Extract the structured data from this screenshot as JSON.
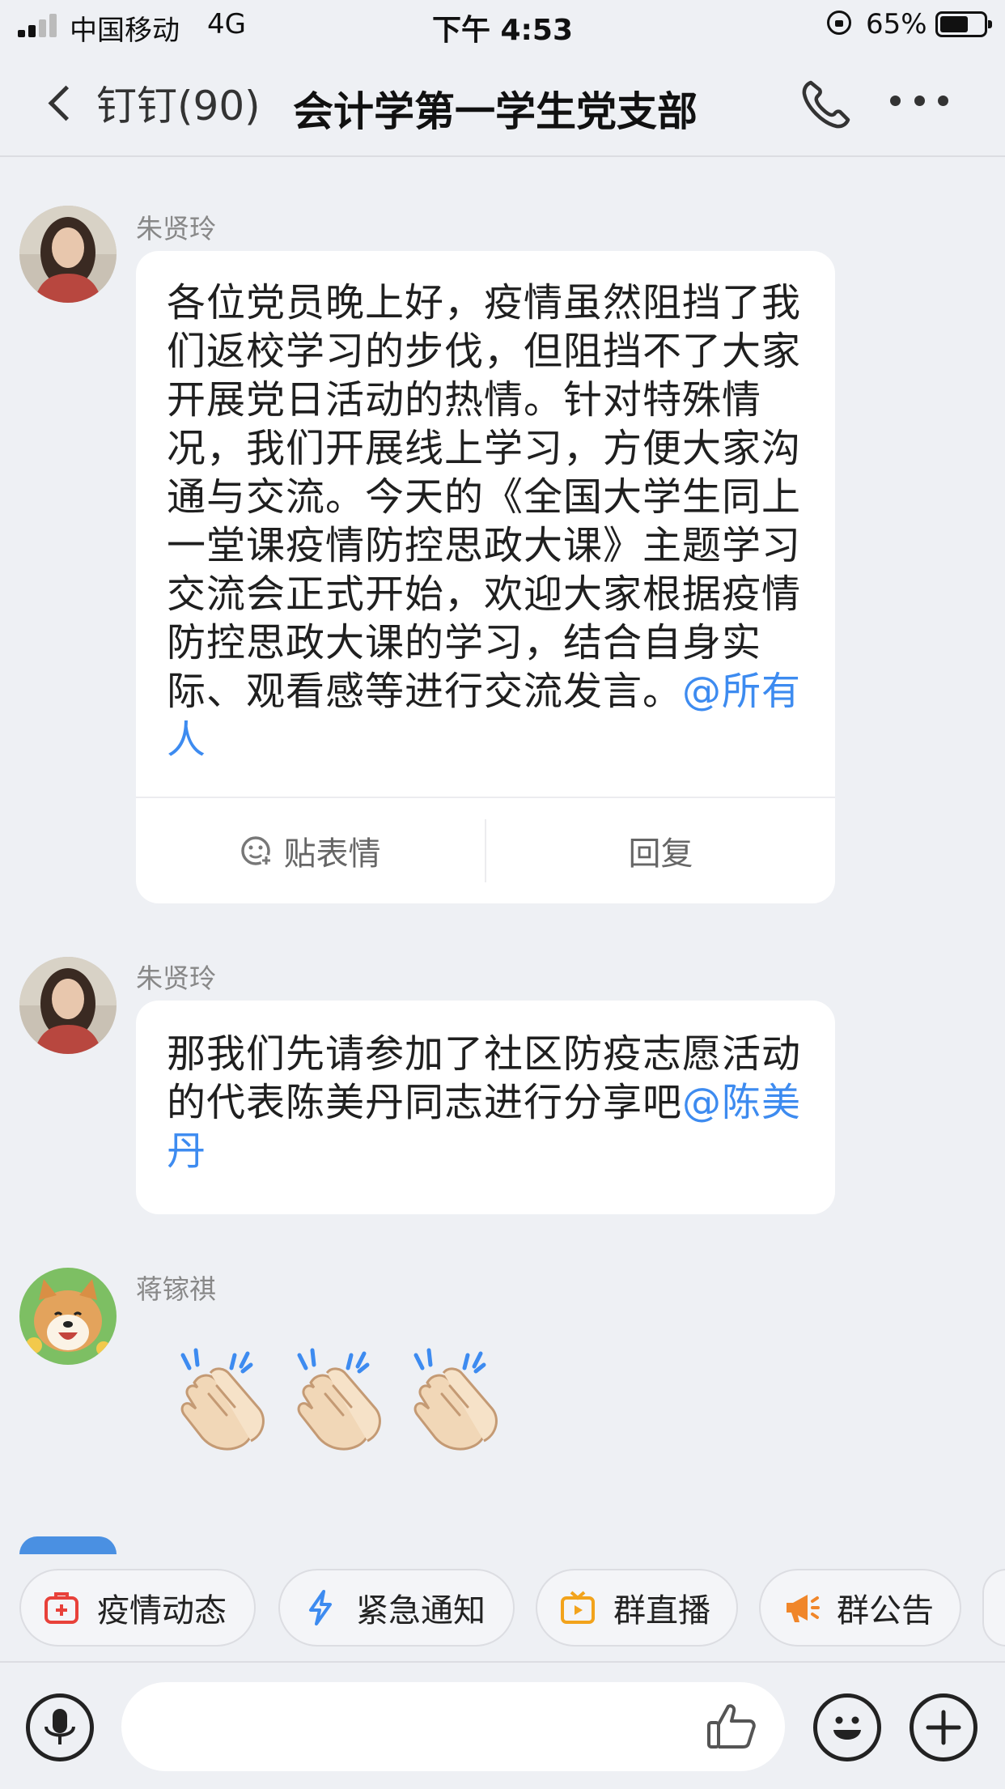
{
  "status_bar": {
    "carrier": "中国移动",
    "network": "4G",
    "time": "下午 4:53",
    "battery_percent": "65%",
    "battery_level": 0.65
  },
  "nav": {
    "back_label": "钉钉(90)",
    "title": "会计学第一学生党支部"
  },
  "messages": [
    {
      "sender": "朱贤玲",
      "text": "各位党员晚上好，疫情虽然阻挡了我们返校学习的步伐，但阻挡不了大家开展党日活动的热情。针对特殊情况，我们开展线上学习，方便大家沟通与交流。今天的《全国大学生同上一堂课疫情防控思政大课》主题学习交流会正式开始，欢迎大家根据疫情防控思政大课的学习，结合自身实际、观看感等进行交流发言。",
      "mention": "@所有人",
      "action_react": "贴表情",
      "action_reply": "回复"
    },
    {
      "sender": "朱贤玲",
      "text": "那我们先请参加了社区防疫志愿活动的代表陈美丹同志进行分享吧",
      "mention": "@陈美丹"
    },
    {
      "sender": "蒋镓祺",
      "emoji_count": 3,
      "emoji": "clapping-hands"
    }
  ],
  "quick_actions": [
    {
      "label": "疫情动态",
      "icon": "medical-kit-icon",
      "color": "#e8413a"
    },
    {
      "label": "紧急通知",
      "icon": "lightning-icon",
      "color": "#3d8bf0"
    },
    {
      "label": "群直播",
      "icon": "tv-icon",
      "color": "#f2a31c"
    },
    {
      "label": "群公告",
      "icon": "megaphone-icon",
      "color": "#f0862a"
    }
  ],
  "input": {
    "placeholder": ""
  },
  "colors": {
    "background": "#eef0f4",
    "mention": "#3d8bf0",
    "bubble": "#ffffff"
  }
}
